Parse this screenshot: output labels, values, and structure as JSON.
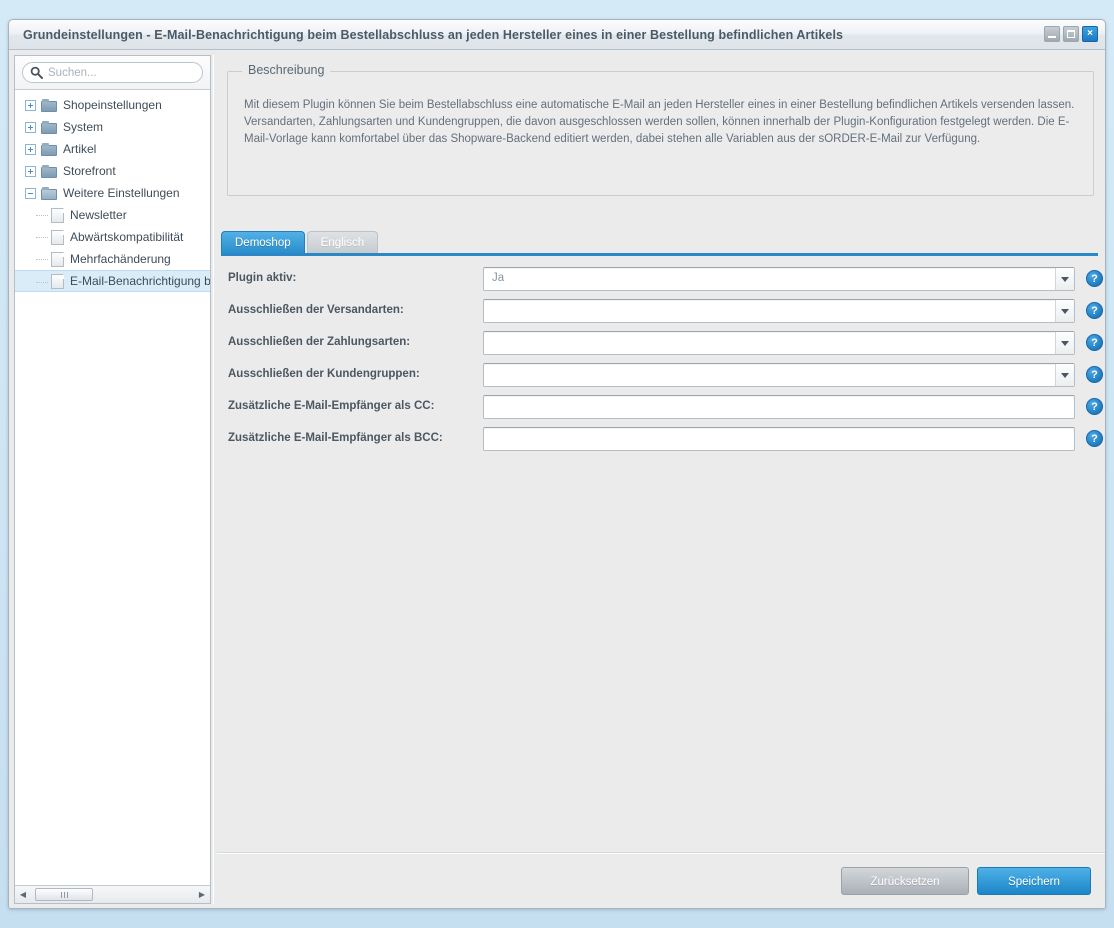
{
  "window": {
    "title": "Grundeinstellungen - E-Mail-Benachrichtigung beim Bestellabschluss an jeden Hersteller eines in einer Bestellung befindlichen Artikels",
    "controls": {
      "minimize": "minimize-button",
      "maximize": "maximize-button",
      "close": "×"
    }
  },
  "sidebar": {
    "search": {
      "placeholder": "Suchen...",
      "value": ""
    },
    "tree": [
      {
        "label": "Shopeinstellungen",
        "type": "folder",
        "expanded": false,
        "level": 0
      },
      {
        "label": "System",
        "type": "folder",
        "expanded": false,
        "level": 0
      },
      {
        "label": "Artikel",
        "type": "folder",
        "expanded": false,
        "level": 0
      },
      {
        "label": "Storefront",
        "type": "folder",
        "expanded": false,
        "level": 0
      },
      {
        "label": "Weitere Einstellungen",
        "type": "folder",
        "expanded": true,
        "level": 0
      },
      {
        "label": "Newsletter",
        "type": "doc",
        "level": 1
      },
      {
        "label": "Abwärtskompatibilität",
        "type": "doc",
        "level": 1
      },
      {
        "label": "Mehrfachänderung",
        "type": "doc",
        "level": 1
      },
      {
        "label": "E-Mail-Benachrichtigung beim B",
        "type": "doc",
        "level": 1,
        "selected": true
      }
    ]
  },
  "description": {
    "legend": "Beschreibung",
    "text": "Mit diesem Plugin können Sie beim Bestellabschluss eine automatische E-Mail an jeden Hersteller eines in einer Bestellung befindlichen Artikels versenden lassen. Versandarten, Zahlungsarten und Kundengruppen, die davon ausgeschlossen werden sollen, können innerhalb der Plugin-Konfiguration festgelegt werden. Die E-Mail-Vorlage kann komfortabel über das Shopware-Backend editiert werden, dabei stehen alle Variablen aus der sORDER-E-Mail zur Verfügung."
  },
  "tabs": [
    {
      "label": "Demoshop",
      "active": true
    },
    {
      "label": "Englisch",
      "active": false
    }
  ],
  "form": {
    "help_glyph": "?",
    "rows": [
      {
        "label": "Plugin aktiv:",
        "value": "Ja",
        "control": "dropdown"
      },
      {
        "label": "Ausschließen der Versandarten:",
        "value": "",
        "control": "dropdown"
      },
      {
        "label": "Ausschließen der Zahlungsarten:",
        "value": "",
        "control": "dropdown"
      },
      {
        "label": "Ausschließen der Kundengruppen:",
        "value": "",
        "control": "dropdown"
      },
      {
        "label": "Zusätzliche E-Mail-Empfänger als CC:",
        "value": "",
        "control": "text"
      },
      {
        "label": "Zusätzliche E-Mail-Empfänger als BCC:",
        "value": "",
        "control": "text"
      }
    ]
  },
  "footer": {
    "reset_label": "Zurücksetzen",
    "save_label": "Speichern"
  },
  "scrollbar": {
    "left_arrow": "◀",
    "right_arrow": "▶"
  },
  "colors": {
    "accent": "#2a8ecb",
    "page_bg": "#cfe8f5",
    "panel_bg": "#ebebeb",
    "selected_row": "#d9ecf8"
  }
}
